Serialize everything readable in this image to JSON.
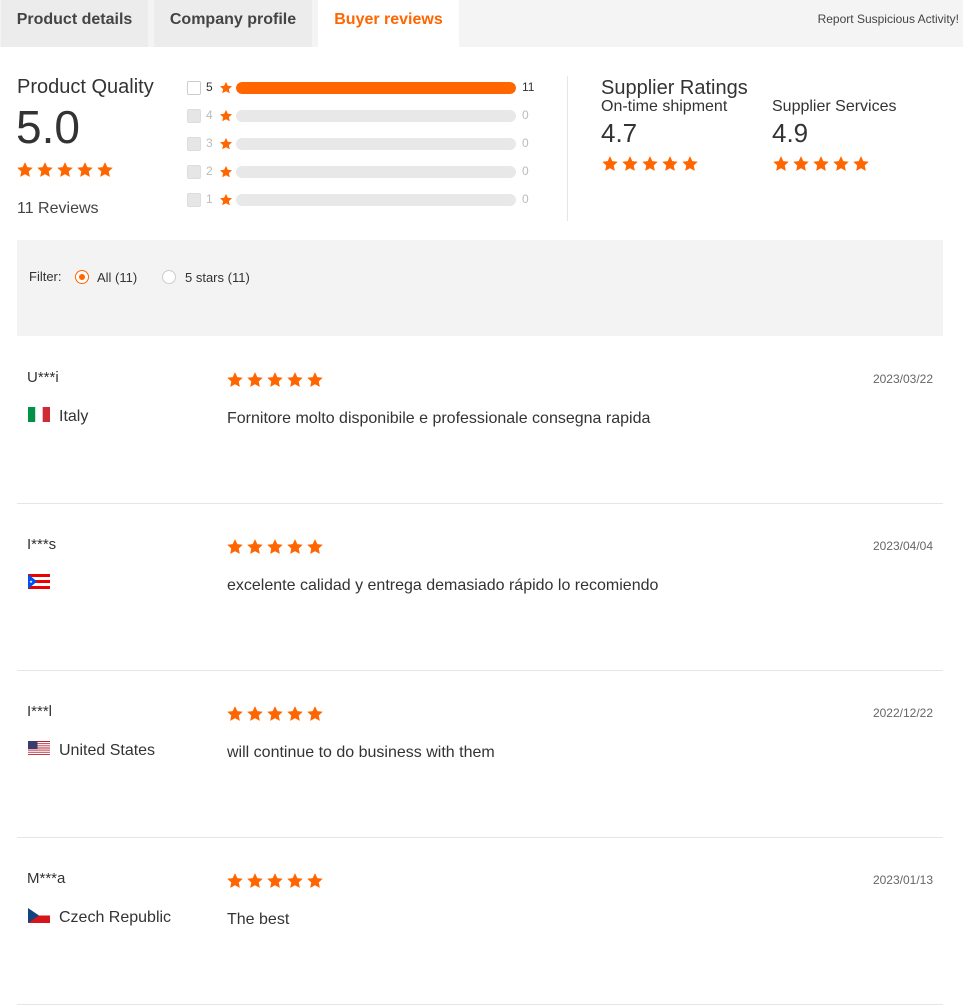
{
  "tabs": [
    {
      "label": "Product details",
      "active": false
    },
    {
      "label": "Company profile",
      "active": false
    },
    {
      "label": "Buyer reviews",
      "active": true
    }
  ],
  "report_link": "Report Suspicious Activity!",
  "product_quality": {
    "title": "Product Quality",
    "score": "5.0",
    "star_rating": 5,
    "reviews_label": "11 Reviews",
    "breakdown": [
      {
        "stars": "5",
        "count": "11",
        "fraction": 1.0
      },
      {
        "stars": "4",
        "count": "0",
        "fraction": 0
      },
      {
        "stars": "3",
        "count": "0",
        "fraction": 0
      },
      {
        "stars": "2",
        "count": "0",
        "fraction": 0
      },
      {
        "stars": "1",
        "count": "0",
        "fraction": 0
      }
    ]
  },
  "supplier_ratings": {
    "title": "Supplier Ratings",
    "items": [
      {
        "label": "On-time shipment",
        "score": "4.7",
        "star_rating": 5
      },
      {
        "label": "Supplier Services",
        "score": "4.9",
        "star_rating": 5
      }
    ]
  },
  "filter": {
    "label": "Filter:",
    "options": [
      {
        "label": "All (11)",
        "selected": true
      },
      {
        "label": "5 stars (11)",
        "selected": false
      }
    ]
  },
  "reviews": [
    {
      "name": "U***i",
      "country": "Italy",
      "flag": "italy-flag",
      "rating": 5,
      "date": "2023/03/22",
      "text": "Fornitore molto disponibile e professionale consegna rapida"
    },
    {
      "name": "I***s",
      "country": "",
      "flag": "puerto-rico-flag",
      "rating": 5,
      "date": "2023/04/04",
      "text": "excelente calidad y entrega demasiado rápido lo recomiendo"
    },
    {
      "name": "I***l",
      "country": "United States",
      "flag": "united-states-flag",
      "rating": 5,
      "date": "2022/12/22",
      "text": "will continue to do business with them"
    },
    {
      "name": "M***a",
      "country": "Czech Republic",
      "flag": "czech-republic-flag",
      "rating": 5,
      "date": "2023/01/13",
      "text": "The best"
    }
  ],
  "colors": {
    "accent": "#ff6600",
    "track": "#e8e8e8",
    "filter_bg": "#f3f3f3"
  }
}
